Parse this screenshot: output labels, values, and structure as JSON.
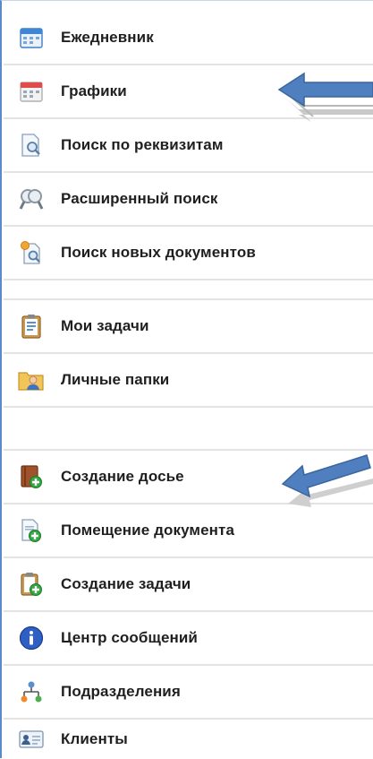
{
  "menu": {
    "items": [
      {
        "label": "Ежедневник",
        "icon": "calendar-blue-icon"
      },
      {
        "label": "Графики",
        "icon": "calendar-red-icon"
      },
      {
        "label": "Поиск по реквизитам",
        "icon": "document-search-icon"
      },
      {
        "label": "Расширенный поиск",
        "icon": "magnifier-icon"
      },
      {
        "label": "Поиск новых документов",
        "icon": "new-document-search-icon"
      },
      {
        "label": "Мои задачи",
        "icon": "clipboard-tasks-icon"
      },
      {
        "label": "Личные папки",
        "icon": "user-folder-icon"
      },
      {
        "label": "Создание досье",
        "icon": "dossier-add-icon"
      },
      {
        "label": "Помещение документа",
        "icon": "document-add-icon"
      },
      {
        "label": "Создание задачи",
        "icon": "task-add-icon"
      },
      {
        "label": "Центр сообщений",
        "icon": "info-icon"
      },
      {
        "label": "Подразделения",
        "icon": "org-structure-icon"
      },
      {
        "label": "Клиенты",
        "icon": "client-card-icon"
      }
    ]
  },
  "colors": {
    "arrow": "#4f7fbf",
    "frame_border": "#5b8bc7",
    "separator": "#e3e3e3"
  }
}
